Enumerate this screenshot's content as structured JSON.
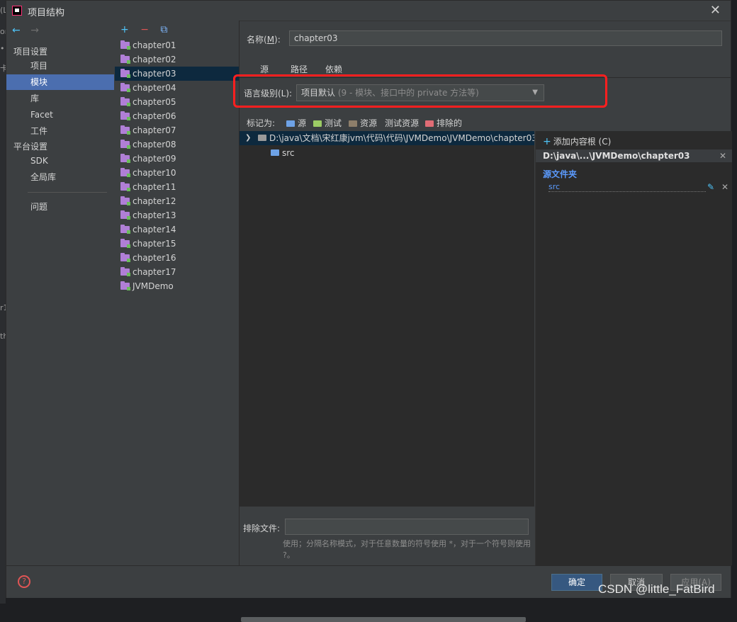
{
  "background_fragments": [
    "(L",
    "on",
    "•",
    "卡",
    "r1",
    "th"
  ],
  "window": {
    "title": "项目结构",
    "close_glyph": "✕"
  },
  "nav": {
    "back": "←",
    "forward": "→",
    "section_project": "项目设置",
    "items_project": [
      "项目",
      "模块",
      "库",
      "Facet",
      "工件"
    ],
    "section_platform": "平台设置",
    "items_platform": [
      "SDK",
      "全局库"
    ],
    "problems": "问题",
    "selected": "模块"
  },
  "modules_toolbar": {
    "add": "+",
    "remove": "−",
    "copy": "⧉"
  },
  "modules": [
    "chapter01",
    "chapter02",
    "chapter03",
    "chapter04",
    "chapter05",
    "chapter06",
    "chapter07",
    "chapter08",
    "chapter09",
    "chapter10",
    "chapter11",
    "chapter12",
    "chapter13",
    "chapter14",
    "chapter15",
    "chapter16",
    "chapter17",
    "JVMDemo"
  ],
  "selected_module": "chapter03",
  "detail": {
    "name_label_prefix": "名称(",
    "name_label_key": "M",
    "name_label_suffix": "):",
    "name_value": "chapter03",
    "tabs": [
      "源",
      "路径",
      "依赖"
    ],
    "lang_label": "语言级别(L):",
    "lang_value": "项目默认",
    "lang_hint": "(9 - 模块、接口中的 private 方法等)",
    "mark_as_label": "标记为:",
    "mark_buttons": [
      {
        "label": "源",
        "color": "#6ea2e6"
      },
      {
        "label": "测试",
        "color": "#9ccc65"
      },
      {
        "label": "资源",
        "color": "#8d7e6a"
      },
      {
        "label": "测试资源",
        "color": ""
      },
      {
        "label": "排除的",
        "color": "#e06c75"
      }
    ],
    "tree_root": "D:\\java\\文档\\宋红康jvm\\代码\\代码\\JVMDemo\\JVMDemo\\chapter03",
    "tree_child": "src",
    "exclude_label": "排除文件:",
    "exclude_value": "",
    "exclude_help": "使用；分隔名称模式，对于任意数量的符号使用 *，对于一个符号则使用 ?。"
  },
  "content_roots": {
    "add_label": "添加内容根 (C)",
    "root_path": "D:\\java\\...\\JVMDemo\\chapter03",
    "source_folders_title": "源文件夹",
    "source_entry": "src"
  },
  "buttons": {
    "ok": "确定",
    "cancel": "取消",
    "apply": "应用(A)",
    "help": "?"
  },
  "watermark": "CSDN @little_FatBird",
  "colors": {
    "highlight_box": "#ff1f1f",
    "selection": "#4b6eaf",
    "accent": "#4fc3f7"
  }
}
